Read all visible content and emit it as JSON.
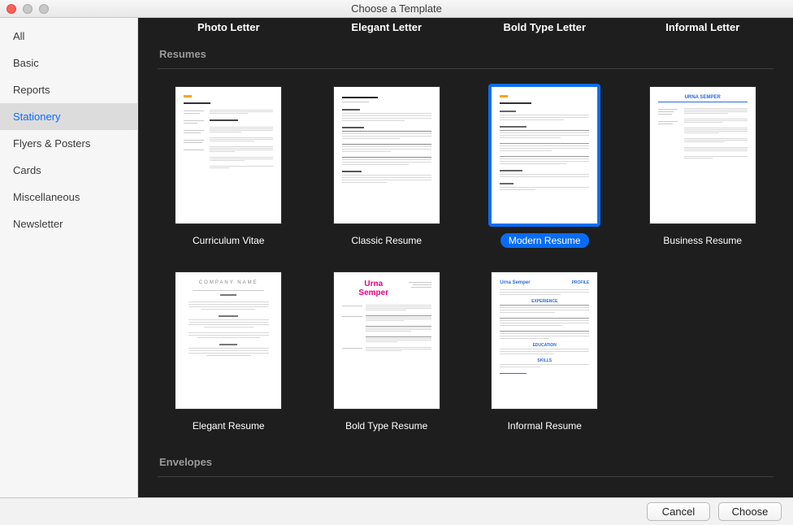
{
  "window": {
    "title": "Choose a Template"
  },
  "sidebar": {
    "items": [
      {
        "label": "All",
        "selected": false
      },
      {
        "label": "Basic",
        "selected": false
      },
      {
        "label": "Reports",
        "selected": false
      },
      {
        "label": "Stationery",
        "selected": true
      },
      {
        "label": "Flyers & Posters",
        "selected": false
      },
      {
        "label": "Cards",
        "selected": false
      },
      {
        "label": "Miscellaneous",
        "selected": false
      },
      {
        "label": "Newsletter",
        "selected": false
      }
    ]
  },
  "sections": {
    "letters_cutoff": {
      "items": [
        "Photo Letter",
        "Elegant Letter",
        "Bold Type Letter",
        "Informal Letter"
      ]
    },
    "resumes": {
      "header": "Resumes",
      "items": [
        {
          "label": "Curriculum Vitae",
          "selected": false,
          "style": "cv"
        },
        {
          "label": "Classic Resume",
          "selected": false,
          "style": "classic"
        },
        {
          "label": "Modern Resume",
          "selected": true,
          "style": "modern"
        },
        {
          "label": "Business Resume",
          "selected": false,
          "style": "business"
        },
        {
          "label": "Elegant Resume",
          "selected": false,
          "style": "elegant"
        },
        {
          "label": "Bold Type Resume",
          "selected": false,
          "style": "boldtype"
        },
        {
          "label": "Informal Resume",
          "selected": false,
          "style": "informal"
        }
      ]
    },
    "envelopes": {
      "header": "Envelopes"
    }
  },
  "thumb_text": {
    "boldtype_name": "Urna\nSemper",
    "elegant_company": "COMPANY NAME"
  },
  "footer": {
    "cancel": "Cancel",
    "choose": "Choose"
  }
}
